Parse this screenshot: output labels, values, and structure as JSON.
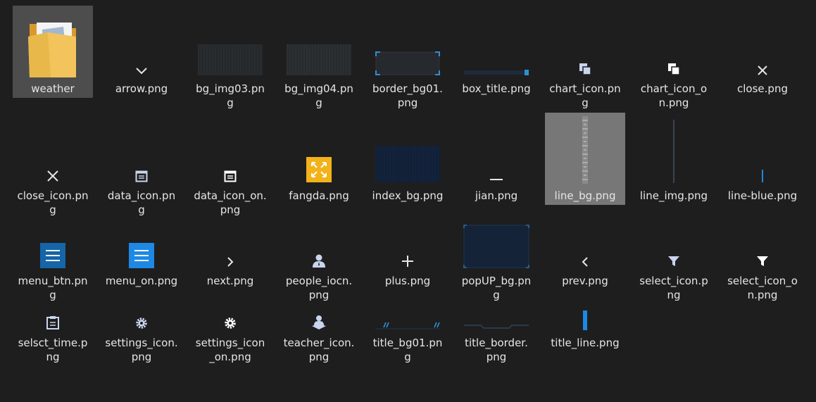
{
  "folder": {
    "items": [
      {
        "name": "weather",
        "icon": "folder-icon",
        "selected": true
      },
      {
        "name": "arrow.png",
        "icon": "chevron-down-icon"
      },
      {
        "name": "bg_img03.png",
        "icon": "dark-texture-thumbnail"
      },
      {
        "name": "bg_img04.png",
        "icon": "dark-texture-thumbnail"
      },
      {
        "name": "border_bg01.png",
        "icon": "cornered-frame-thumbnail"
      },
      {
        "name": "box_title.png",
        "icon": "title-bar-thumbnail"
      },
      {
        "name": "chart_icon.png",
        "icon": "stacked-squares-icon"
      },
      {
        "name": "chart_icon_on.png",
        "icon": "stacked-squares-icon"
      },
      {
        "name": "close.png",
        "icon": "close-icon"
      },
      {
        "name": "close_icon.png",
        "icon": "close-icon"
      },
      {
        "name": "data_icon.png",
        "icon": "calendar-icon"
      },
      {
        "name": "data_icon_on.png",
        "icon": "calendar-icon"
      },
      {
        "name": "fangda.png",
        "icon": "expand-icon"
      },
      {
        "name": "index_bg.png",
        "icon": "dark-blue-thumbnail"
      },
      {
        "name": "jian.png",
        "icon": "minus-icon"
      },
      {
        "name": "line_bg.png",
        "icon": "ruler-thumbnail",
        "selected": true
      },
      {
        "name": "line_img.png",
        "icon": "vertical-line-thumbnail"
      },
      {
        "name": "line-blue.png",
        "icon": "vertical-line-thumbnail"
      },
      {
        "name": "menu_btn.png",
        "icon": "hamburger-menu-icon"
      },
      {
        "name": "menu_on.png",
        "icon": "hamburger-menu-icon"
      },
      {
        "name": "next.png",
        "icon": "chevron-right-icon"
      },
      {
        "name": "people_iocn.png",
        "icon": "person-icon"
      },
      {
        "name": "plus.png",
        "icon": "plus-icon"
      },
      {
        "name": "popUP_bg.png",
        "icon": "popup-panel-thumbnail"
      },
      {
        "name": "prev.png",
        "icon": "chevron-left-icon"
      },
      {
        "name": "select_icon.png",
        "icon": "filter-icon"
      },
      {
        "name": "select_icon_on.png",
        "icon": "filter-icon"
      },
      {
        "name": "selsct_time.png",
        "icon": "clipboard-icon"
      },
      {
        "name": "settings_icon.png",
        "icon": "gear-icon"
      },
      {
        "name": "settings_icon_on.png",
        "icon": "gear-icon"
      },
      {
        "name": "teacher_icon.png",
        "icon": "teacher-icon"
      },
      {
        "name": "title_bg01.png",
        "icon": "title-bar-thumbnail"
      },
      {
        "name": "title_border.png",
        "icon": "title-border-thumbnail"
      },
      {
        "name": "title_line.png",
        "icon": "blue-bar-thumbnail"
      }
    ]
  },
  "labels": [
    "weather",
    "arrow.png",
    "bg_img03.pn\ng",
    "bg_img04.pn\ng",
    "border_bg01.\npng",
    "box_title.png",
    "chart_icon.pn\ng",
    "chart_icon_o\nn.png",
    "close.png",
    "close_icon.pn\ng",
    "data_icon.pn\ng",
    "data_icon_on.\npng",
    "fangda.png",
    "index_bg.png",
    "jian.png",
    "line_bg.png",
    "line_img.png",
    "line-blue.png",
    "menu_btn.pn\ng",
    "menu_on.png",
    "next.png",
    "people_iocn.\npng",
    "plus.png",
    "popUP_bg.pn\ng",
    "prev.png",
    "select_icon.p\nng",
    "select_icon_o\nn.png",
    "selsct_time.p\nng",
    "settings_icon.\npng",
    "settings_icon\n_on.png",
    "teacher_icon.\npng",
    "title_bg01.pn\ng",
    "title_border.\npng",
    "title_line.png"
  ],
  "colors": {
    "background": "#1e1e1e",
    "selection": "#777777",
    "folder": "#e8b84a",
    "accent_blue": "#1e88e5",
    "menu_blue": "#1565a8",
    "fangda_yellow": "#f2b21a"
  }
}
